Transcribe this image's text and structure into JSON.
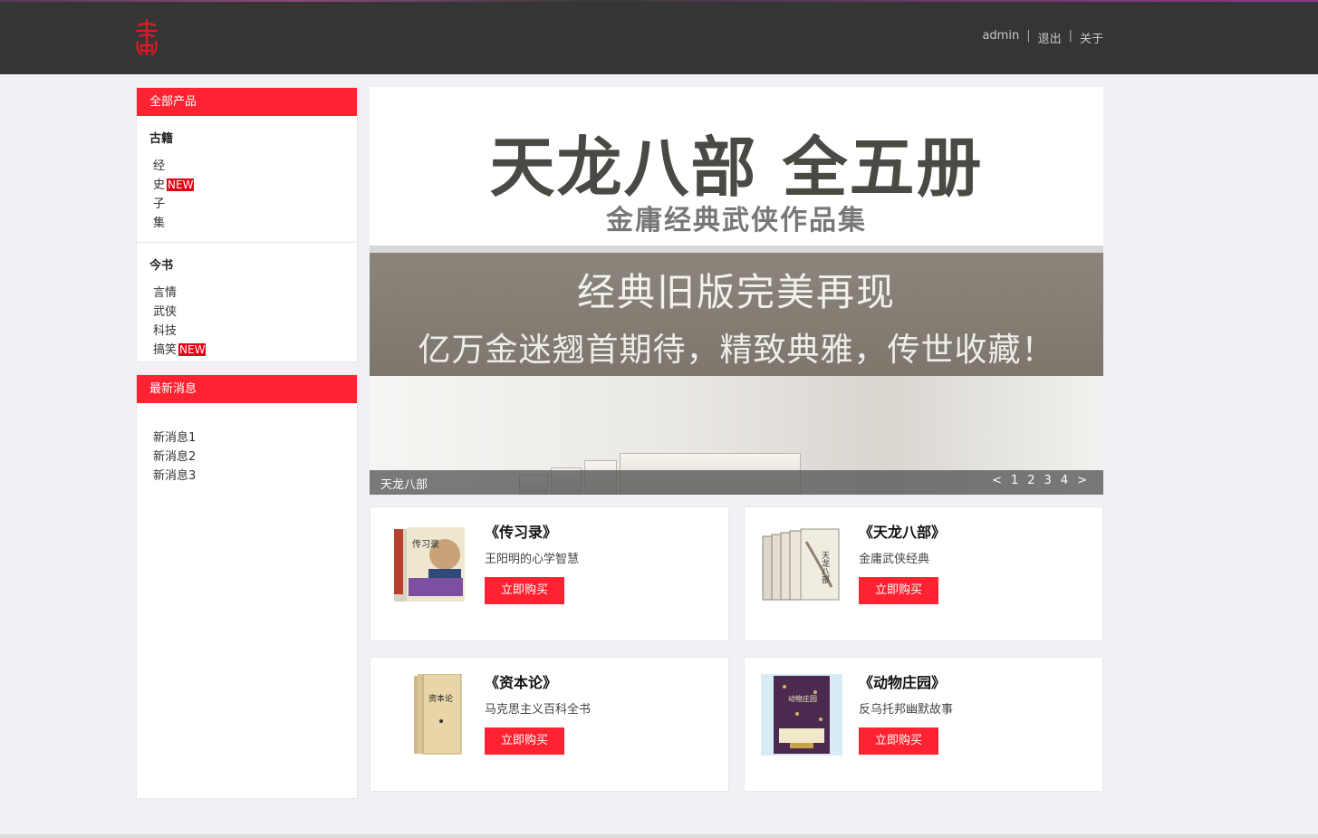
{
  "header": {
    "logo_char": "書",
    "nav": [
      "admin",
      "退出",
      "关于"
    ]
  },
  "sidebar": {
    "products_title": "全部产品",
    "groups": [
      {
        "title": "古籍",
        "items": [
          {
            "label": "经",
            "badge": ""
          },
          {
            "label": "史",
            "badge": "NEW"
          },
          {
            "label": "子",
            "badge": ""
          },
          {
            "label": "集",
            "badge": ""
          }
        ]
      },
      {
        "title": "今书",
        "items": [
          {
            "label": "言情",
            "badge": ""
          },
          {
            "label": "武侠",
            "badge": ""
          },
          {
            "label": "科技",
            "badge": ""
          },
          {
            "label": "搞笑",
            "badge": "NEW"
          }
        ]
      }
    ],
    "news_title": "最新消息",
    "news": [
      "新消息1",
      "新消息2",
      "新消息3"
    ]
  },
  "banner": {
    "title": "天龙八部  全五册",
    "subtitle": "金庸经典武侠作品集",
    "line1": "经典旧版完美再现",
    "line2": "亿万金迷翘首期待，精致典雅，传世收藏！",
    "caption": "天龙八部",
    "prev": "<",
    "pages": [
      "1",
      "2",
      "3",
      "4"
    ],
    "next": ">"
  },
  "products": [
    {
      "title": "《传习录》",
      "desc": "王阳明的心学智慧",
      "button": "立即购买",
      "cover_text": "传习录"
    },
    {
      "title": "《天龙八部》",
      "desc": "金庸武侠经典",
      "button": "立即购买",
      "cover_text": "天龙八部"
    },
    {
      "title": "《资本论》",
      "desc": "马克思主义百科全书",
      "button": "立即购买",
      "cover_text": "资本论"
    },
    {
      "title": "《动物庄园》",
      "desc": "反乌托邦幽默故事",
      "button": "立即购买",
      "cover_text": "动物庄园"
    }
  ],
  "colors": {
    "accent": "#ff2332",
    "header_bg": "#353535",
    "page_bg": "#f0f1f4",
    "new_badge": "#e60012"
  }
}
